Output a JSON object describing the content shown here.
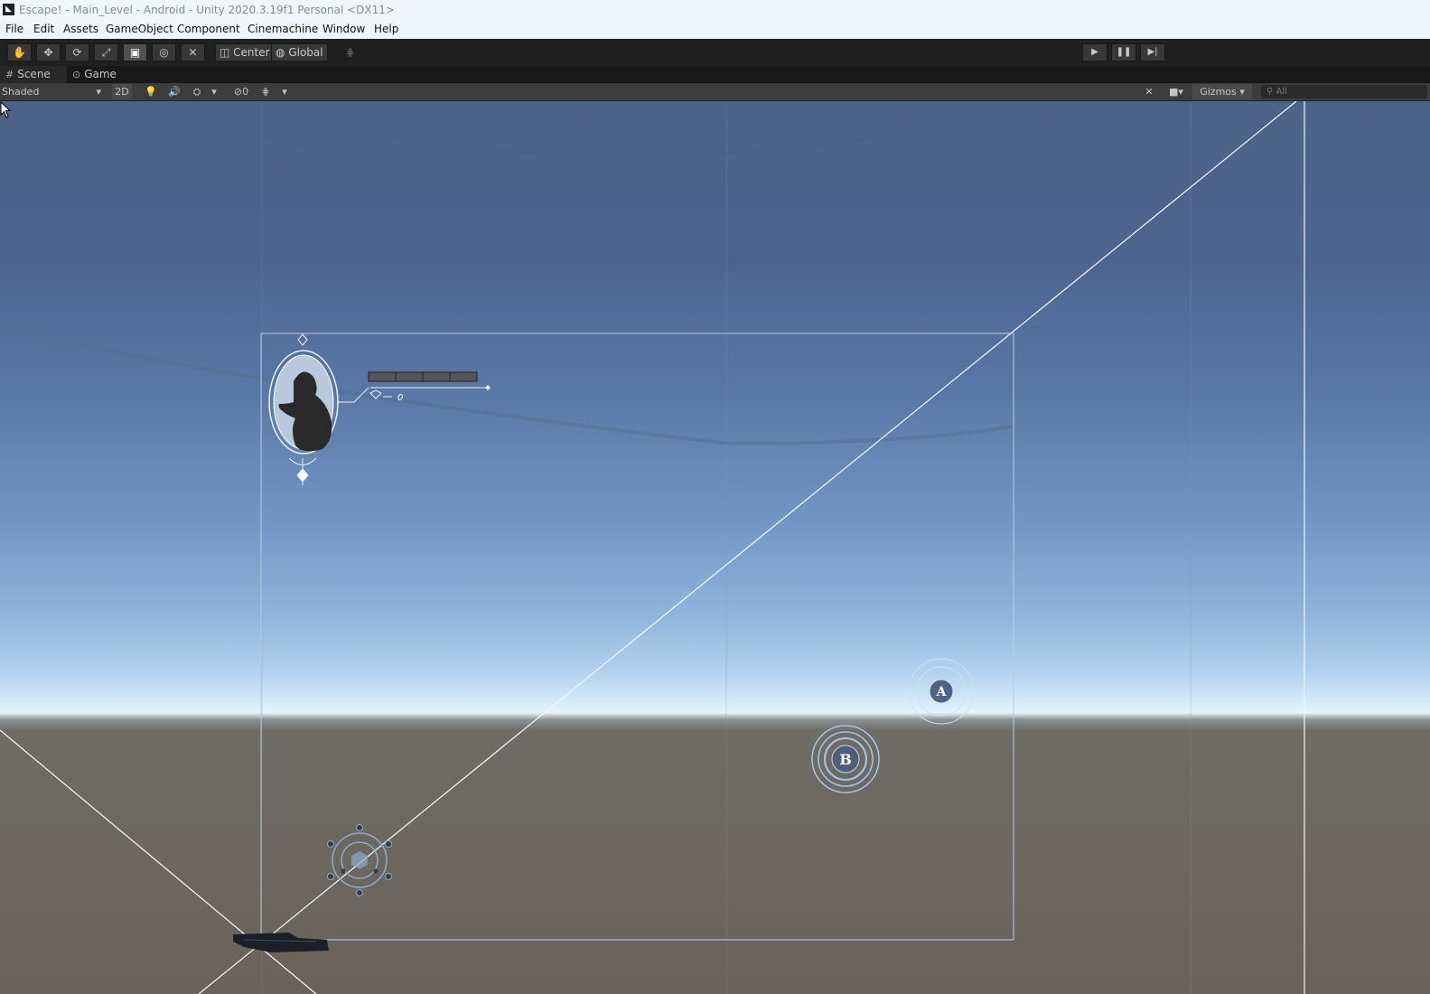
{
  "window": {
    "app_icon": "unity-icon",
    "title": "Escape! - Main_Level - Android - Unity 2020.3.19f1 Personal <DX11>"
  },
  "menu": [
    "File",
    "Edit",
    "Assets",
    "GameObject",
    "Component",
    "Cinemachine",
    "Window",
    "Help"
  ],
  "toolbar": {
    "tools": [
      "hand-tool-icon",
      "move-tool-icon",
      "rotate-tool-icon",
      "scale-tool-icon",
      "rect-tool-icon",
      "transform-tool-icon",
      "custom-tool-icon"
    ],
    "active_tool": "rect-tool-icon",
    "pivot_label": "Center",
    "space_label": "Global",
    "play_controls": [
      "play-icon",
      "pause-icon",
      "step-icon"
    ]
  },
  "tabs": {
    "scene": "Scene",
    "game": "Game"
  },
  "scene_toolbar": {
    "draw_mode": "Shaded",
    "toggle_2d": "2D",
    "hidden_count": "0",
    "gizmos_label": "Gizmos",
    "search_placeholder": "All"
  },
  "scene": {
    "hud_counter": "0",
    "button_a": "A",
    "button_b": "B"
  },
  "colors": {
    "editor_dark": "#202020",
    "titlebar": "#f0f6fb",
    "sky_top": "#4b6388",
    "horizon": "#e6f4fc",
    "ground": "#6a655c",
    "ui_outline": "#a9c4e6"
  }
}
